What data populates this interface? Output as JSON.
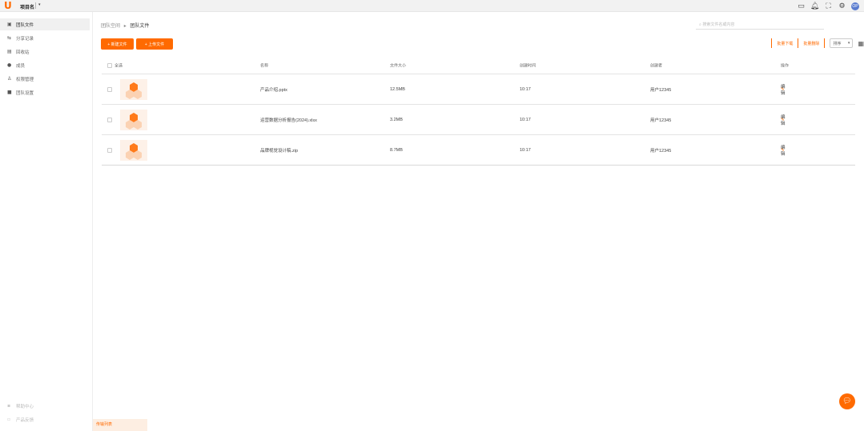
{
  "topbar": {
    "logo": "U",
    "workspace": "项目名",
    "icons": [
      "screen-icon",
      "bell-icon",
      "fullscreen-icon",
      "gear-icon"
    ],
    "avatar": "OP"
  },
  "sidebar": {
    "items": [
      {
        "label": "团队文件",
        "icon": "folder-icon",
        "active": true
      },
      {
        "label": "分享记录",
        "icon": "share-icon",
        "active": false
      },
      {
        "label": "回收站",
        "icon": "trash-icon",
        "active": false
      },
      {
        "label": "成员",
        "icon": "user-icon",
        "active": false
      },
      {
        "label": "权限管理",
        "icon": "group-icon",
        "active": false
      },
      {
        "label": "团队设置",
        "icon": "settings-icon",
        "active": false
      }
    ],
    "bottom_items": [
      {
        "label": "帮助中心",
        "icon": "help-icon"
      },
      {
        "label": "产品反馈",
        "icon": "feedback-icon"
      }
    ]
  },
  "breadcrumb": {
    "root": "团队空间",
    "separator": "▸",
    "current": "团队文件"
  },
  "search": {
    "placeholder": "搜索文件名或内容"
  },
  "toolbar": {
    "new_button": "+ 新建文件",
    "upload_button": "+ 上传文件",
    "batch_download": "批量下载",
    "batch_delete": "批量删除",
    "sort_label": "排序",
    "sort_arrow": "▾"
  },
  "table": {
    "headers": [
      "全选",
      "名称",
      "文件大小",
      "创建时间",
      "创建者",
      "操作"
    ],
    "rows": [
      {
        "name": "产品介绍.pptx",
        "size": "12.5MB",
        "created": "10:17",
        "creator": "用户12345",
        "action": "编辑"
      },
      {
        "name": "运营数据分析报告(2024).xlsx",
        "size": "3.2MB",
        "created": "10:17",
        "creator": "用户12345",
        "action": "编辑"
      },
      {
        "name": "品牌视觉设计稿.zip",
        "size": "8.7MB",
        "created": "10:17",
        "creator": "用户12345",
        "action": "编辑"
      }
    ]
  },
  "bottom_tab": {
    "label": "传输列表"
  },
  "colors": {
    "accent": "#ff6a00"
  }
}
